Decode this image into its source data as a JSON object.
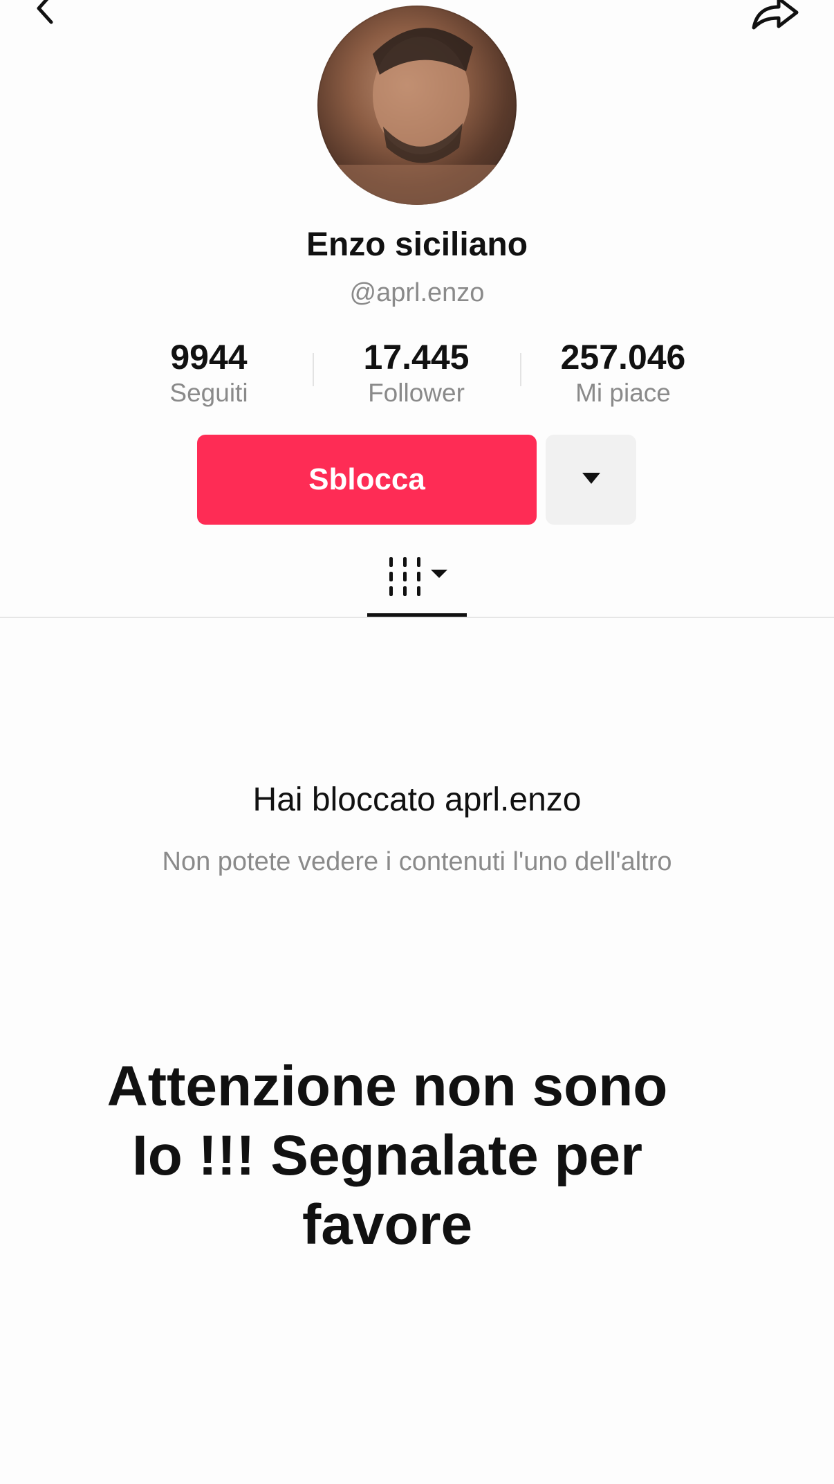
{
  "profile": {
    "display_name": "Enzo siciliano",
    "username": "@aprl.enzo"
  },
  "stats": [
    {
      "value": "9944",
      "label": "Seguiti"
    },
    {
      "value": "17.445",
      "label": "Follower"
    },
    {
      "value": "257.046",
      "label": "Mi piace"
    }
  ],
  "actions": {
    "unblock_label": "Sblocca"
  },
  "blocked_notice": {
    "title": "Hai bloccato aprl.enzo",
    "subtitle": "Non potete vedere i contenuti l'uno dell'altro"
  },
  "overlay_message": {
    "line1": "Attenzione non sono",
    "line2": "Io !!! Segnalate per favore"
  },
  "icons": {
    "back": "back-arrow-icon",
    "share": "share-icon",
    "more": "caret-down-icon",
    "tab": "grid-videos-icon"
  },
  "colors": {
    "accent": "#fe2c55",
    "secondary_button": "#f1f1f1",
    "muted_text": "#8a8a8a"
  }
}
